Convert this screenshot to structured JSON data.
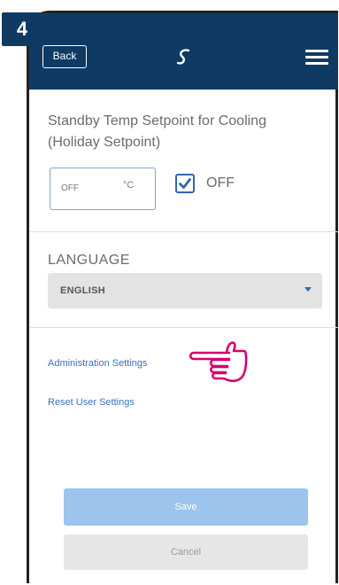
{
  "step": {
    "number": "4"
  },
  "header": {
    "back_label": "Back",
    "logo_icon": "salus-logo-icon",
    "menu_icon": "hamburger-menu-icon",
    "background_color": "#0f3a63"
  },
  "setpoint": {
    "label": "Standby Temp Setpoint for Cooling (Holiday Setpoint)",
    "value": "OFF",
    "unit": "°C",
    "off_checkbox_checked": true,
    "off_label": "OFF"
  },
  "language": {
    "label": "LANGUAGE",
    "selected": "ENGLISH"
  },
  "links": {
    "administration": "Administration Settings",
    "reset_user": "Reset User Settings"
  },
  "annotation": {
    "icon": "pointing-hand-icon",
    "color": "#d6006e"
  },
  "buttons": {
    "save": "Save",
    "cancel": "Cancel"
  }
}
